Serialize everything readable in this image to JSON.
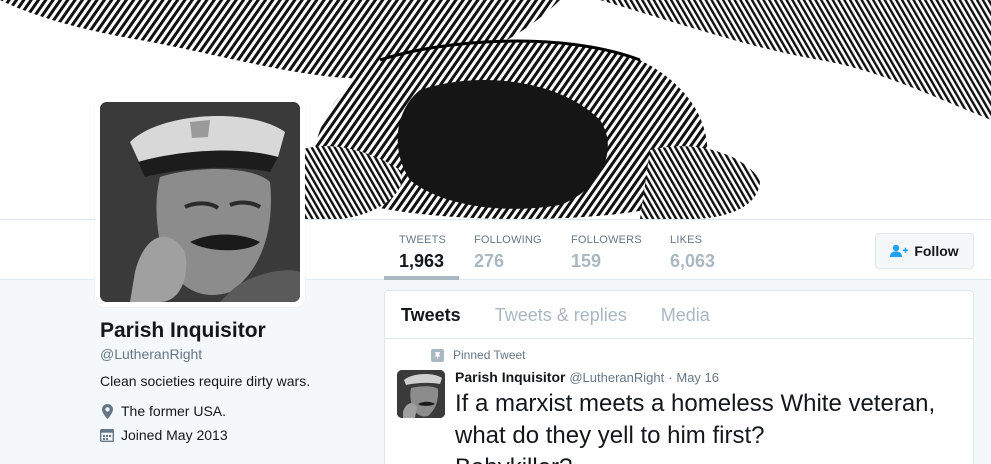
{
  "stats": [
    {
      "label": "TWEETS",
      "value": "1,963"
    },
    {
      "label": "FOLLOWING",
      "value": "276"
    },
    {
      "label": "FOLLOWERS",
      "value": "159"
    },
    {
      "label": "LIKES",
      "value": "6,063"
    }
  ],
  "follow_button": {
    "label": "Follow",
    "icon": "add-user-icon"
  },
  "profile": {
    "name": "Parish Inquisitor",
    "handle": "@LutheranRight",
    "bio": "Clean societies require dirty wars.",
    "location": "The former USA.",
    "joined": "Joined May 2013"
  },
  "timeline": {
    "tabs": [
      "Tweets",
      "Tweets & replies",
      "Media"
    ],
    "pinned_label": "Pinned Tweet",
    "tweet": {
      "name": "Parish Inquisitor",
      "handle": "@LutheranRight",
      "separator": "·",
      "date": "May 16",
      "text_lines": [
        "If a marxist meets a homeless White veteran,",
        "what do they yell to him first?",
        "Babykiller?"
      ]
    }
  },
  "colors": {
    "accent": "#1da1f2",
    "muted": "#657786",
    "faint": "#aab8c2",
    "border": "#e1e8ed"
  }
}
